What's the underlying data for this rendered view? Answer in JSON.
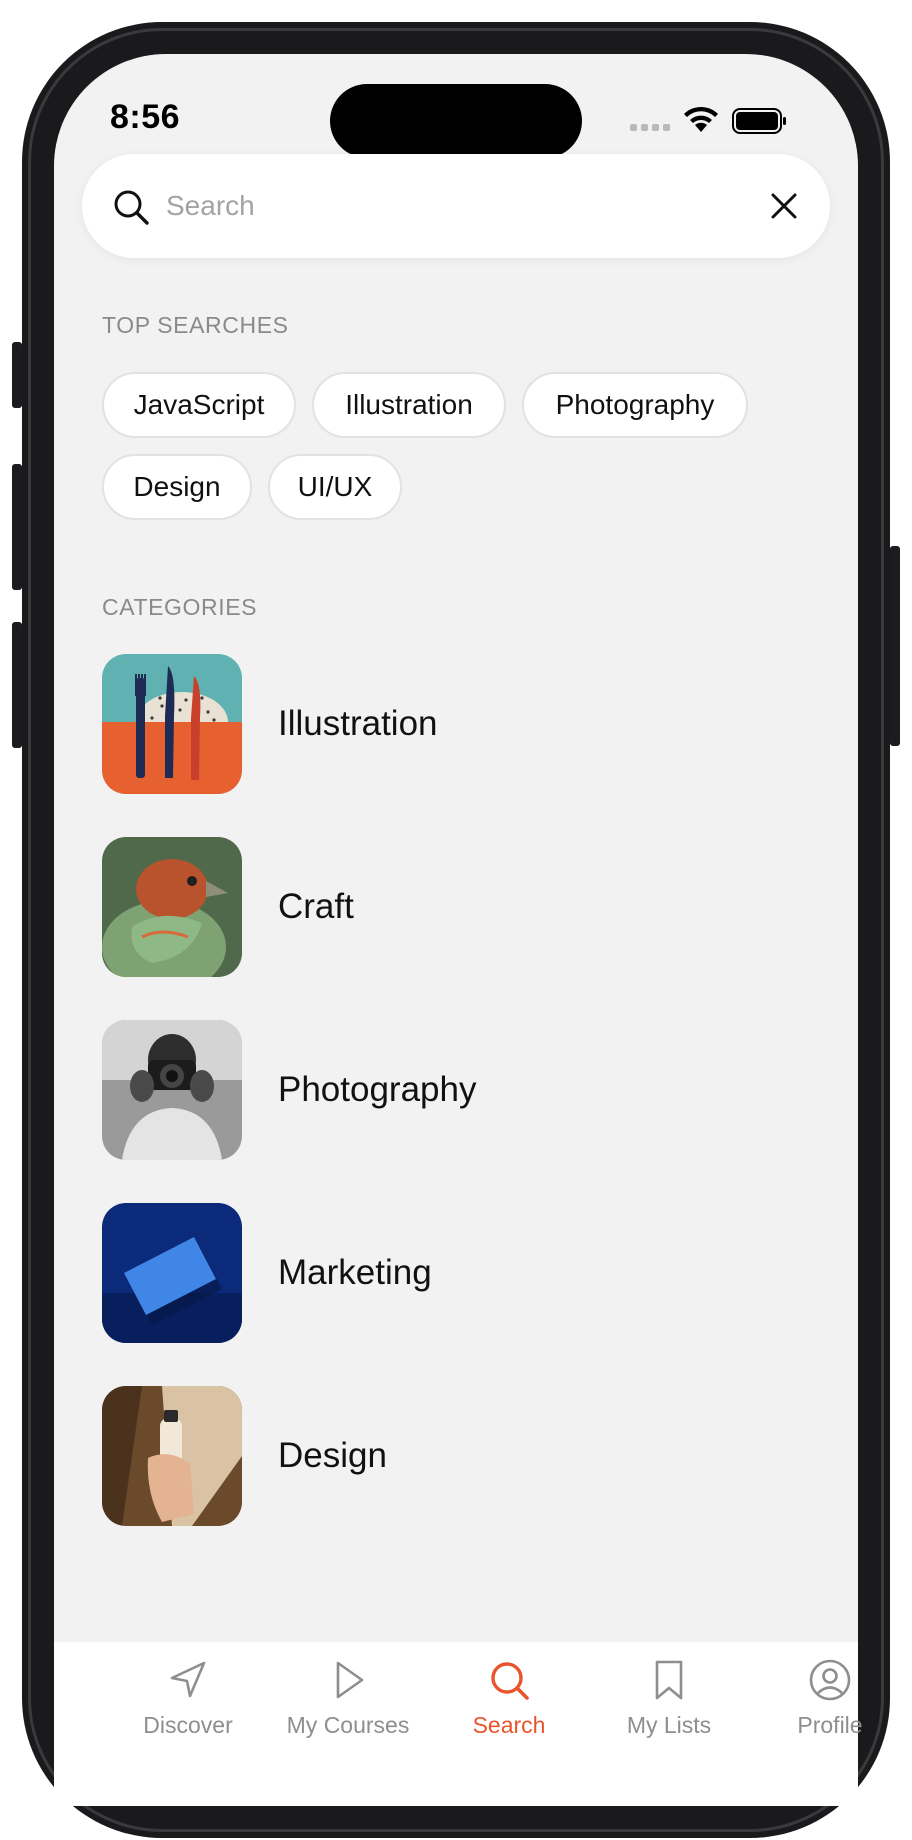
{
  "status_bar": {
    "time": "8:56"
  },
  "search": {
    "placeholder": "Search",
    "value": ""
  },
  "top_searches": {
    "header": "TOP SEARCHES",
    "chips": [
      "JavaScript",
      "Illustration",
      "Photography",
      "Design",
      "UI/UX"
    ]
  },
  "categories": {
    "header": "CATEGORIES",
    "items": [
      {
        "label": "Illustration",
        "thumbnail": "fork-knives-illustration"
      },
      {
        "label": "Craft",
        "thumbnail": "bird-sculpture"
      },
      {
        "label": "Photography",
        "thumbnail": "photographer-with-camera"
      },
      {
        "label": "Marketing",
        "thumbnail": "blue-card-on-navy"
      },
      {
        "label": "Design",
        "thumbnail": "hand-holding-bottle"
      }
    ]
  },
  "tab_bar": {
    "active_color": "#e8542d",
    "inactive_color": "#8e8e8e",
    "tabs": [
      {
        "label": "Discover",
        "icon": "navigation-arrow-icon",
        "active": false
      },
      {
        "label": "My Courses",
        "icon": "play-icon",
        "active": false
      },
      {
        "label": "Search",
        "icon": "search-icon",
        "active": true
      },
      {
        "label": "My Lists",
        "icon": "bookmark-icon",
        "active": false
      },
      {
        "label": "Profile",
        "icon": "user-circle-icon",
        "active": false
      }
    ]
  }
}
